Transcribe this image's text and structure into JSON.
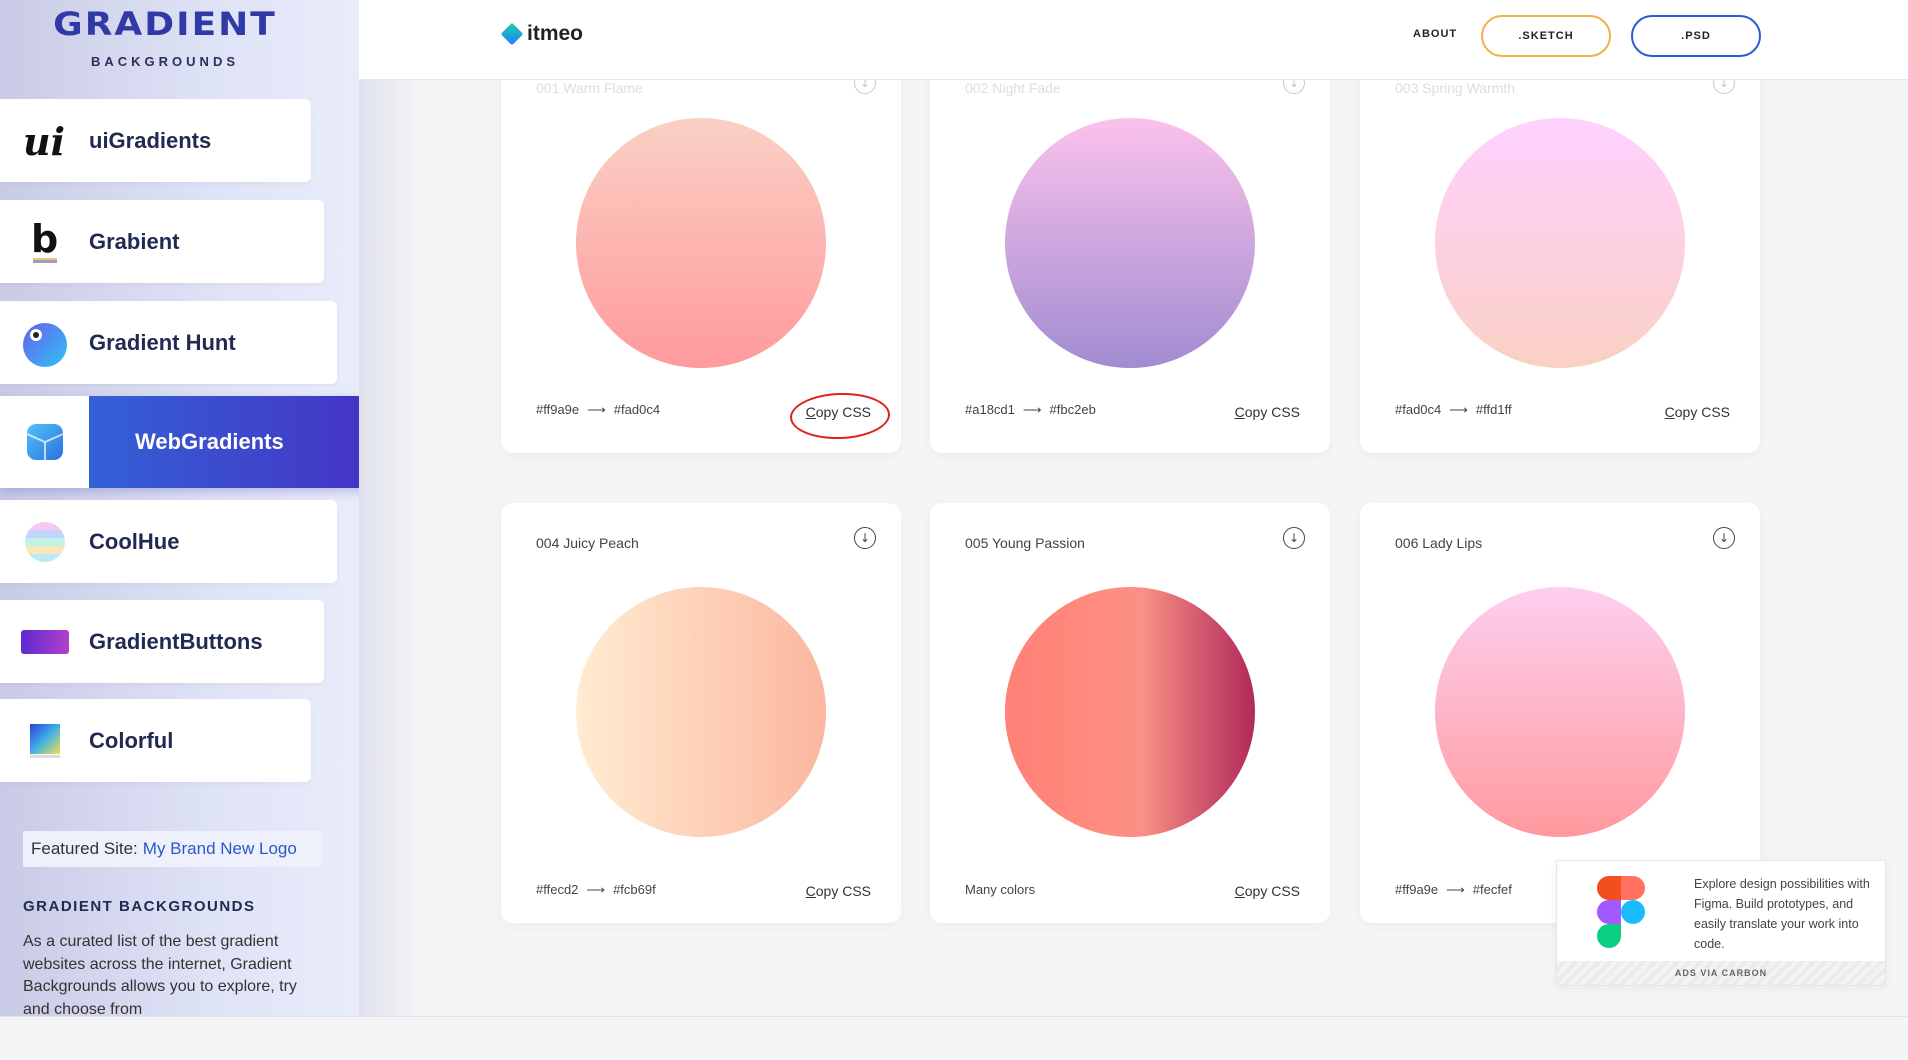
{
  "logo": {
    "title": "GRADIENT",
    "subtitle": "BACKGROUNDS"
  },
  "sidebar": {
    "items": [
      {
        "label": "uiGradients",
        "icon": "ui-script-icon"
      },
      {
        "label": "Grabient",
        "icon": "b-letter-icon"
      },
      {
        "label": "Gradient Hunt",
        "icon": "bird-icon"
      },
      {
        "label": "WebGradients",
        "icon": "cube-icon",
        "active": true
      },
      {
        "label": "CoolHue",
        "icon": "striped-circle-icon"
      },
      {
        "label": "GradientButtons",
        "icon": "gradient-pill-icon"
      },
      {
        "label": "Colorful",
        "icon": "color-square-icon"
      }
    ],
    "featured_prefix": "Featured Site:",
    "featured_link": "My Brand New Logo",
    "heading": "GRADIENT BACKGROUNDS",
    "description": "As a curated list of the best gradient websites across the internet, Gradient Backgrounds allows you to explore, try and choose from"
  },
  "header": {
    "brand": "itmeo",
    "about": "ABOUT",
    "sketch": ".SKETCH",
    "psd": ".PSD"
  },
  "cards": [
    {
      "title": "001 Warm Flame",
      "from": "#ff9a9e",
      "to": "#fad0c4",
      "colors_text": "",
      "copy_prefix": "C",
      "copy_rest": "opy CSS"
    },
    {
      "title": "002 Night Fade",
      "from": "#a18cd1",
      "to": "#fbc2eb",
      "colors_text": "",
      "copy_prefix": "C",
      "copy_rest": "opy CSS"
    },
    {
      "title": "003 Spring Warmth",
      "from": "#fad0c4",
      "to": "#ffd1ff",
      "colors_text": "",
      "copy_prefix": "C",
      "copy_rest": "opy CSS"
    },
    {
      "title": "004 Juicy Peach",
      "from": "#ffecd2",
      "to": "#fcb69f",
      "colors_text": "",
      "copy_prefix": "C",
      "copy_rest": "opy CSS"
    },
    {
      "title": "005 Young Passion",
      "from": "",
      "to": "",
      "colors_text": "Many colors",
      "copy_prefix": "C",
      "copy_rest": "opy CSS"
    },
    {
      "title": "006 Lady Lips",
      "from": "#ff9a9e",
      "to": "#fecfef",
      "colors_text": "",
      "copy_prefix": "",
      "copy_rest": ""
    }
  ],
  "arrow": "⟶",
  "download_glyph": "↓",
  "ad": {
    "text": "Explore design possibilities with Figma. Build prototypes, and easily translate your work into code.",
    "footer": "ADS VIA CARBON"
  },
  "colors": {
    "accent_blue": "#2e6fdc",
    "accent_purple": "#4533c4",
    "sketch_border": "#f3b047",
    "psd_border": "#2d5bd8",
    "highlight": "#e11f1f"
  }
}
